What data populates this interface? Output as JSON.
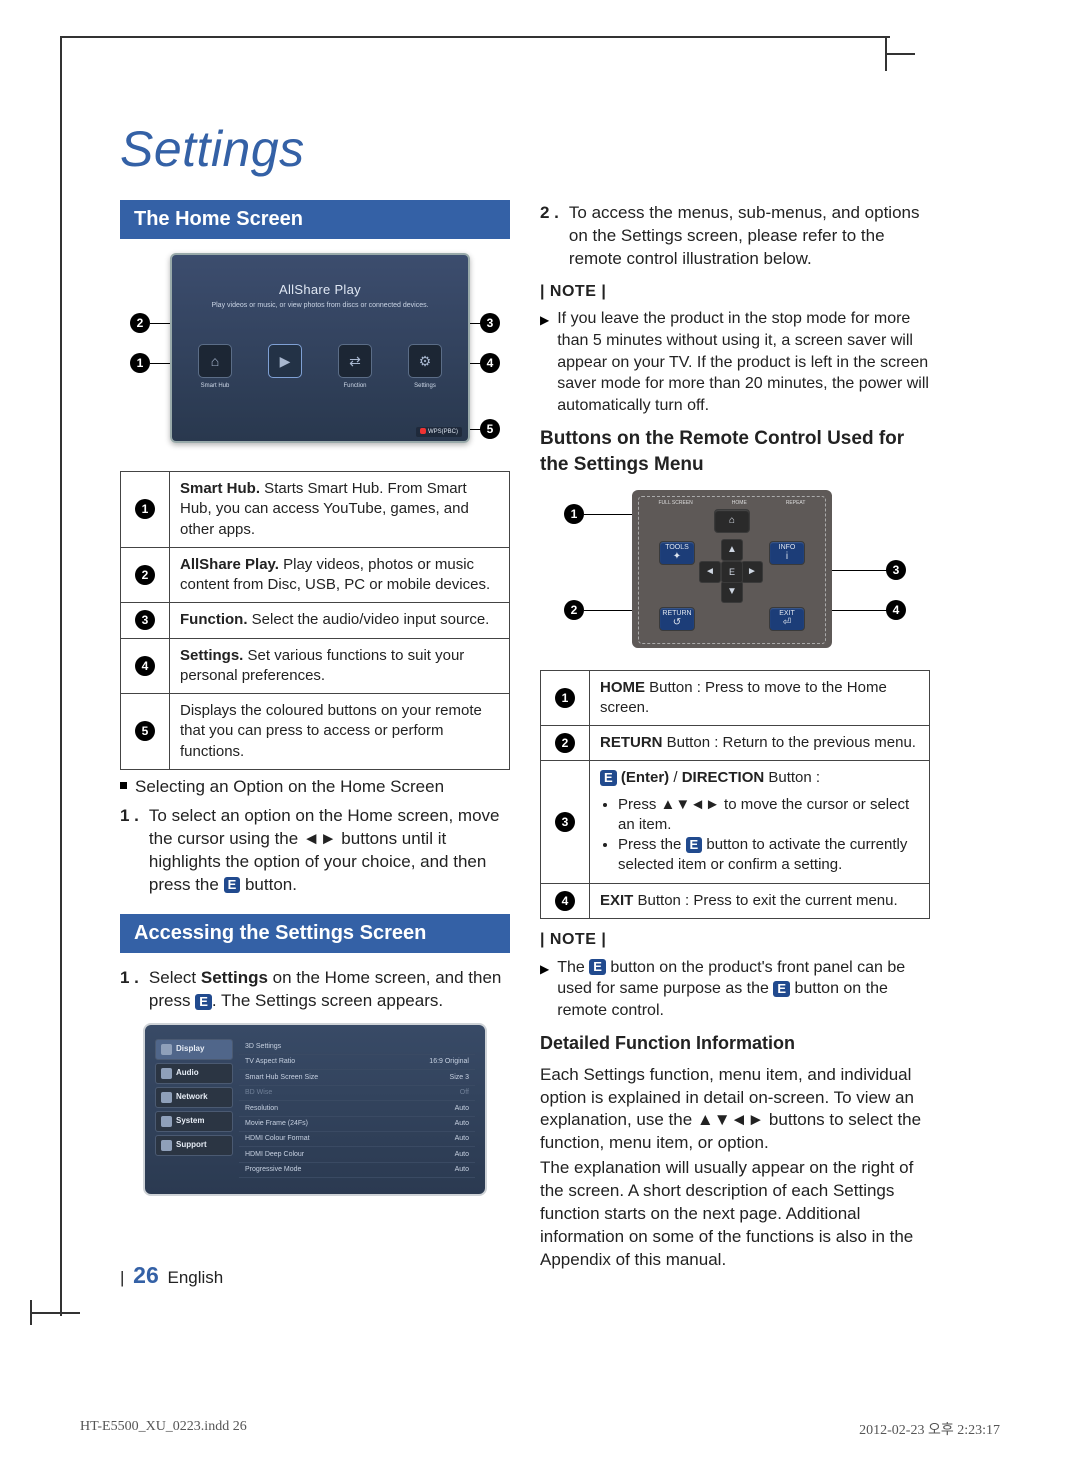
{
  "title": "Settings",
  "sections": {
    "home": "The Home Screen",
    "access": "Accessing the Settings Screen"
  },
  "home_fig": {
    "allshare_title": "AllShare Play",
    "allshare_sub": "Play videos or music, or view photos from discs or connected devices.",
    "icons": {
      "smart_hub": "Smart Hub",
      "function": "Function",
      "settings": "Settings"
    },
    "wps_badge": "WPS(PBC)"
  },
  "home_table": {
    "r1": {
      "title": "Smart Hub.",
      "body": " Starts Smart Hub. From Smart Hub, you can access YouTube, games, and other apps."
    },
    "r2": {
      "title": "AllShare Play.",
      "body": " Play videos, photos or music content from Disc, USB, PC or mobile devices."
    },
    "r3": {
      "title": "Function.",
      "body": " Select the audio/video input source."
    },
    "r4": {
      "title": "Settings.",
      "body": " Set various functions to suit your personal preferences."
    },
    "r5": {
      "body": "Displays the coloured buttons on your remote that you can press to access or perform functions."
    }
  },
  "home_sel_bullet": "Selecting an Option on the Home Screen",
  "home_step1": {
    "n": "1 .",
    "body_a": "To select an option on the Home screen, move the cursor using the ◄► buttons until it highlights the option of your choice, and then press the ",
    "body_b": " button."
  },
  "access_step1": {
    "n": "1 .",
    "body_a": "Select ",
    "bold": "Settings",
    "body_b": " on the Home screen, and then press ",
    "body_c": ". The Settings screen appears."
  },
  "settings_panel": {
    "side": [
      "Display",
      "Audio",
      "Network",
      "System",
      "Support"
    ],
    "opts": [
      {
        "k": "3D Settings",
        "v": ""
      },
      {
        "k": "TV Aspect Ratio",
        "v": "16:9 Original"
      },
      {
        "k": "Smart Hub Screen Size",
        "v": "Size 3"
      },
      {
        "k": "BD Wise",
        "v": "Off",
        "dim": true
      },
      {
        "k": "Resolution",
        "v": "Auto"
      },
      {
        "k": "Movie Frame (24Fs)",
        "v": "Auto"
      },
      {
        "k": "HDMI Colour Format",
        "v": "Auto"
      },
      {
        "k": "HDMI Deep Colour",
        "v": "Auto"
      },
      {
        "k": "Progressive Mode",
        "v": "Auto"
      }
    ]
  },
  "right_step2": {
    "n": "2 .",
    "body": "To access the menus, sub-menus, and options on the Settings screen, please refer to the remote control illustration below."
  },
  "note_label": "| NOTE |",
  "note1": "If you leave the product in the stop mode for more than 5 minutes without using it, a screen saver will appear on your TV. If the product is left in the screen saver mode for more than 20 minutes, the power will automatically turn off.",
  "remote_heading": "Buttons on the Remote Control Used for the Settings Menu",
  "remote_labels": {
    "fullscreen": "FULL SCREEN",
    "home": "HOME",
    "repeat": "REPEAT",
    "tools": "TOOLS",
    "info": "INFO",
    "ret": "RETURN",
    "exit": "EXIT"
  },
  "remote_table": {
    "r1": {
      "title": "HOME",
      "body": " Button : Press to move to the Home screen."
    },
    "r2": {
      "title": "RETURN",
      "body": " Button : Return to the previous menu."
    },
    "r3": {
      "title_a": "(Enter)",
      "title_b": " / ",
      "title_c": "DIRECTION",
      "title_d": " Button :",
      "b1": "Press ▲▼◄► to move the cursor or select an item.",
      "b2a": "Press the ",
      "b2b": " button to activate the currently selected item or confirm a setting."
    },
    "r4": {
      "title": "EXIT",
      "body": " Button : Press to exit the current menu."
    }
  },
  "note2_a": "The ",
  "note2_b": " button on the product's front panel can be used for same purpose as the ",
  "note2_c": " button on the remote control.",
  "detail_head": "Detailed Function Information",
  "detail_p1": "Each Settings function, menu item, and individual option is explained in detail on-screen. To view an explanation, use the ▲▼◄► buttons to select the function, menu item, or option.",
  "detail_p2": "The explanation will usually appear on the right of the screen. A short description of each Settings function starts on the next page. Additional information on some of the functions is also in the Appendix of this manual.",
  "footer": {
    "bar": "|",
    "page": "26",
    "lang": "English"
  },
  "print": {
    "left": "HT-E5500_XU_0223.indd   26",
    "right": "2012-02-23   오후 2:23:17"
  },
  "glyphs": {
    "enter": "E"
  },
  "chart_data": {
    "type": "table",
    "title": "Settings > Display options",
    "columns": [
      "Option",
      "Value"
    ],
    "rows": [
      [
        "3D Settings",
        ""
      ],
      [
        "TV Aspect Ratio",
        "16:9 Original"
      ],
      [
        "Smart Hub Screen Size",
        "Size 3"
      ],
      [
        "BD Wise",
        "Off"
      ],
      [
        "Resolution",
        "Auto"
      ],
      [
        "Movie Frame (24Fs)",
        "Auto"
      ],
      [
        "HDMI Colour Format",
        "Auto"
      ],
      [
        "HDMI Deep Colour",
        "Auto"
      ],
      [
        "Progressive Mode",
        "Auto"
      ]
    ]
  }
}
